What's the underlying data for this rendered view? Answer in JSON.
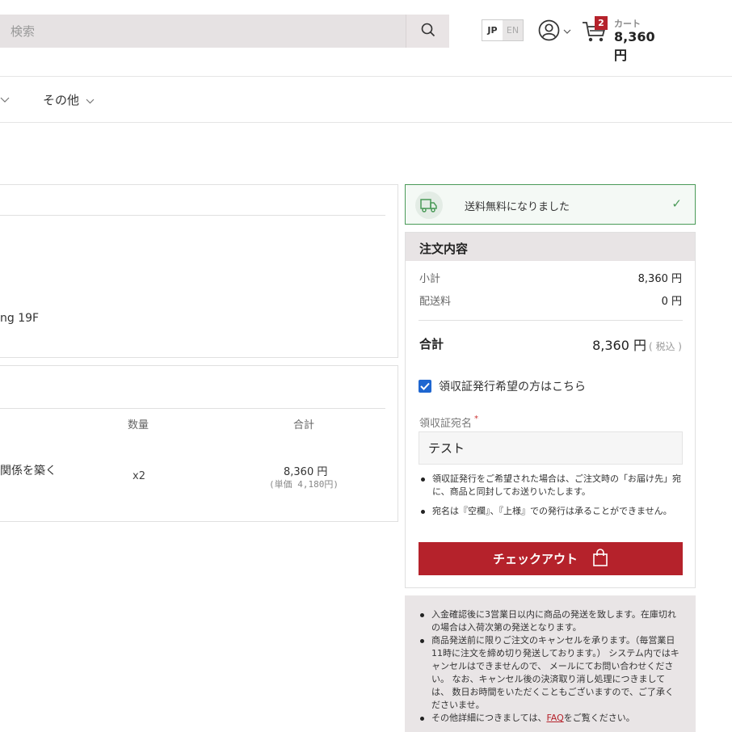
{
  "header": {
    "search_placeholder": "検索",
    "lang_jp": "JP",
    "lang_en": "EN",
    "cart_count": "2",
    "cart_label": "カート",
    "cart_total": "8,360 円"
  },
  "nav": {
    "other_label": "その他"
  },
  "shipping_panel": {
    "address_fragment": "ng 19F"
  },
  "items_panel": {
    "col_qty": "数量",
    "col_total": "合計",
    "product_name_fragment": "関係を築く",
    "product_qty": "x2",
    "product_total": "8,360 円",
    "product_unit_price": "(単価 4,180円)"
  },
  "free_shipping": {
    "message": "送料無料になりました",
    "check": "✓"
  },
  "summary": {
    "title": "注文内容",
    "subtotal_label": "小計",
    "subtotal_value": "8,360 円",
    "shipping_label": "配送料",
    "shipping_value": "0 円",
    "total_label": "合計",
    "total_value": "8,360 円",
    "tax_note": "( 税込 )",
    "receipt_checkbox_label": "領収証発行希望の方はこちら",
    "receipt_checked": true,
    "recipient_label": "領収証宛名",
    "required_mark": "*",
    "recipient_value": "テスト",
    "notes": [
      "領収証発行をご希望された場合は、ご注文時の「お届け先」宛に、商品と同封してお送りいたします。",
      "宛名は『空欄』、『上様』での発行は承ることができません。"
    ],
    "checkout_label": "チェックアウト"
  },
  "info": {
    "items": [
      "入金確認後に3営業日以内に商品の発送を致します。在庫切れの場合は入荷次第の発送となります。",
      "商品発送前に限りご注文のキャンセルを承ります。（毎営業日11時に注文を締め切り発送しております。） システム内ではキャンセルはできませんので、 メールにてお問い合わせください。 なお、キャンセル後の決済取り消し処理につきましては、 数日お時間をいただくこともございますので、ご了承くださいませ。"
    ],
    "last_prefix": "その他詳細につきましては、",
    "faq_link": "FAQ",
    "last_suffix": "をご覧ください。"
  },
  "colors": {
    "accent": "#b5222b",
    "success": "#4a9a58",
    "checkbox": "#1e66d0"
  }
}
